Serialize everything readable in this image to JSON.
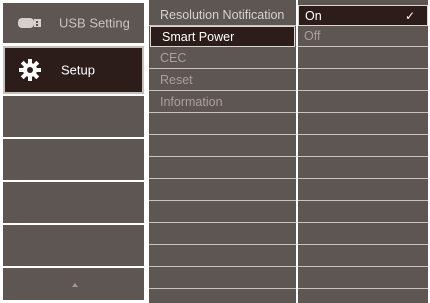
{
  "colors": {
    "panel": "#5e5653",
    "selected": "#2c1c1a",
    "dimText": "#a9a09b",
    "activeText": "#ffffff"
  },
  "left_menu": {
    "items": [
      {
        "label": "USB Setting",
        "icon": "usb-icon",
        "selected": false
      },
      {
        "label": "Setup",
        "icon": "gear-icon",
        "selected": true
      }
    ],
    "scroll_indicator": "up-arrow-icon"
  },
  "middle_menu": {
    "items": [
      {
        "label": "Resolution Notification",
        "state": "normal"
      },
      {
        "label": "Smart Power",
        "state": "selected"
      },
      {
        "label": "CEC",
        "state": "dim"
      },
      {
        "label": "Reset",
        "state": "dim"
      },
      {
        "label": "Information",
        "state": "dim"
      }
    ]
  },
  "right_menu": {
    "items": [
      {
        "label": "On",
        "state": "selected",
        "checked": true,
        "check": "✓"
      },
      {
        "label": "Off",
        "state": "dim",
        "checked": false
      }
    ]
  }
}
